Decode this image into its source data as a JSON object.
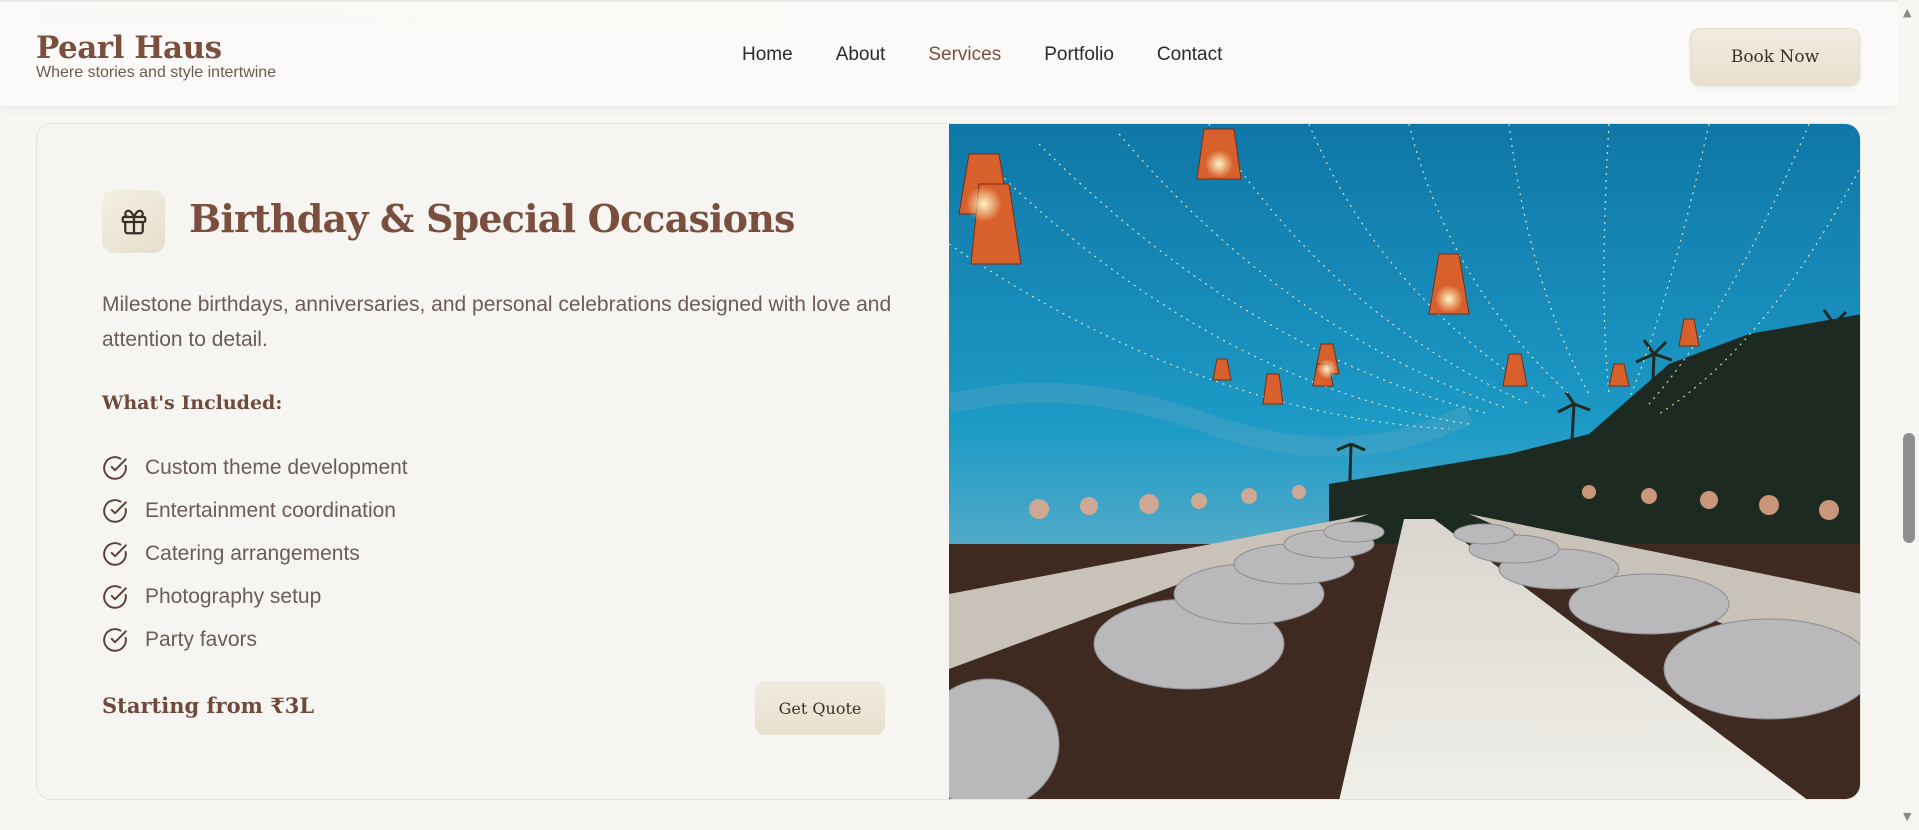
{
  "header": {
    "brand_name": "Pearl Haus",
    "brand_tagline": "Where stories and style intertwine",
    "nav": [
      {
        "label": "Home",
        "active": false
      },
      {
        "label": "About",
        "active": false
      },
      {
        "label": "Services",
        "active": true
      },
      {
        "label": "Portfolio",
        "active": false
      },
      {
        "label": "Contact",
        "active": false
      }
    ],
    "cta_label": "Book Now"
  },
  "service": {
    "icon": "gift-icon",
    "title": "Birthday & Special Occasions",
    "description": "Milestone birthdays, anniversaries, and personal celebrations designed with love and attention to detail.",
    "included_heading": "What's Included:",
    "features": [
      "Custom theme development",
      "Entertainment coordination",
      "Catering arrangements",
      "Photography setup",
      "Party favors"
    ],
    "price": "Starting from ₹3L",
    "quote_label": "Get Quote",
    "image": "beach-party-photo"
  },
  "colors": {
    "brand": "#7a4f3e",
    "accent_button": "#ede6d6",
    "background": "#f8f6f3",
    "text_muted": "#6b5c55"
  }
}
